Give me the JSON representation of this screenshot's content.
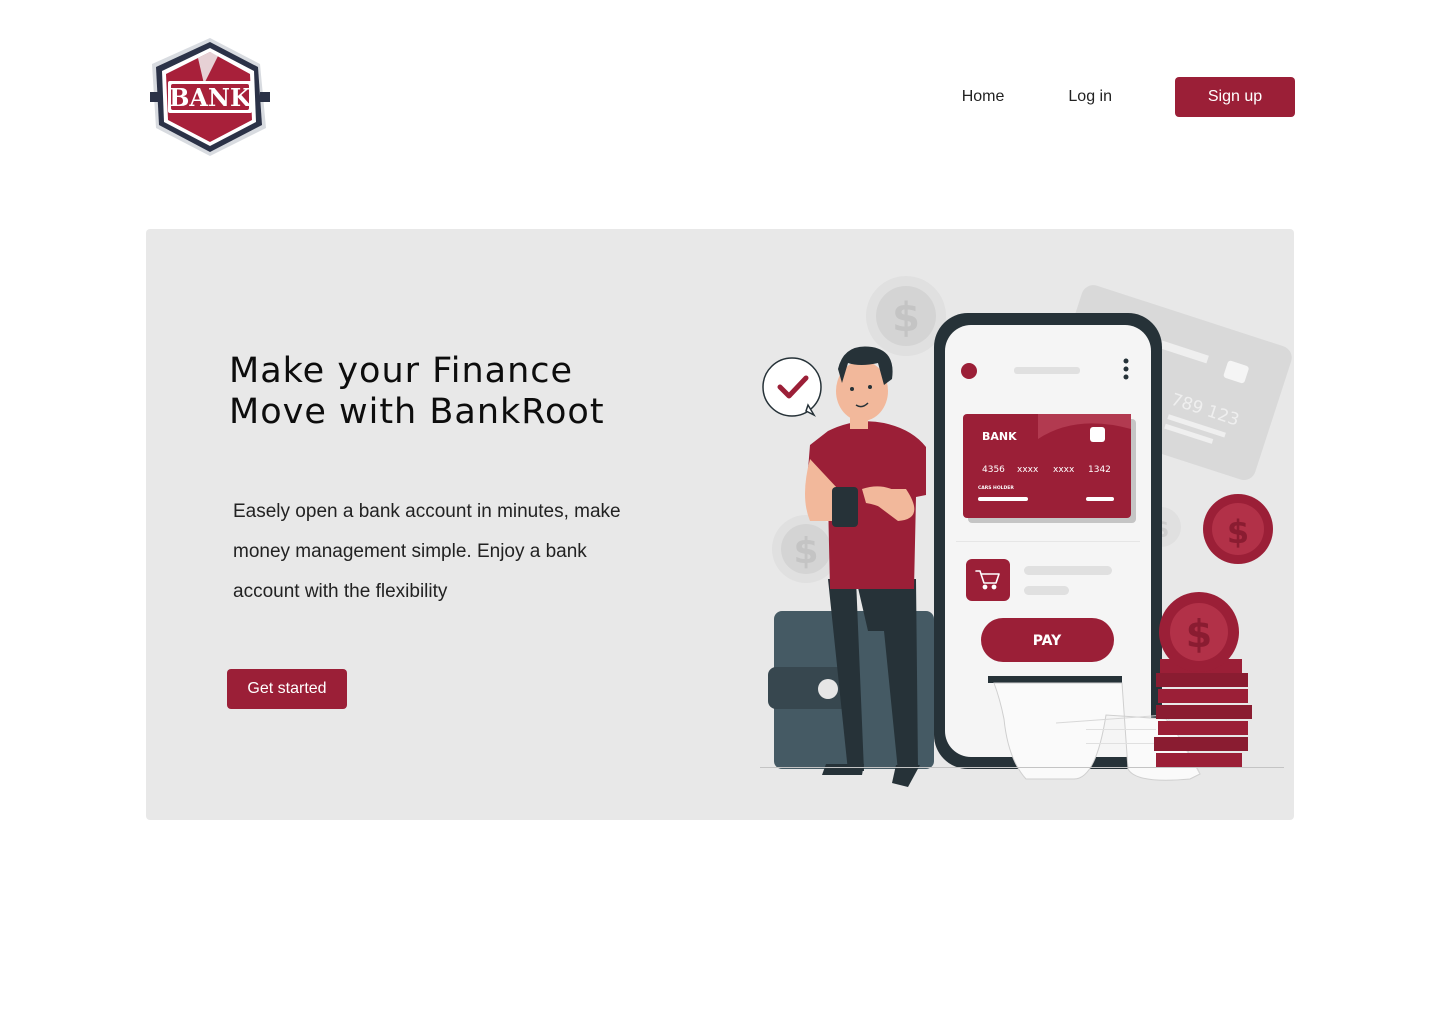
{
  "header": {
    "logo_text": "BANK",
    "nav": {
      "home": "Home",
      "login": "Log in",
      "signup": "Sign up"
    }
  },
  "hero": {
    "headline_line1": "Make your Finance",
    "headline_line2": "Move with BankRoot",
    "description": "Easely open a bank account in minutes, make money management simple. Enjoy a bank account with the flexibility",
    "cta": "Get started"
  },
  "illustration": {
    "card_brand": "BANK",
    "card_number": [
      "4356",
      "xxxx",
      "xxxx",
      "1342"
    ],
    "card_holder": "CARS HOLDER",
    "back_card_digits": "789 123",
    "pay_label": "PAY",
    "coin_symbol": "$"
  },
  "colors": {
    "accent": "#9b1f37",
    "hero_bg": "#e8e8e8",
    "dark": "#263238"
  }
}
